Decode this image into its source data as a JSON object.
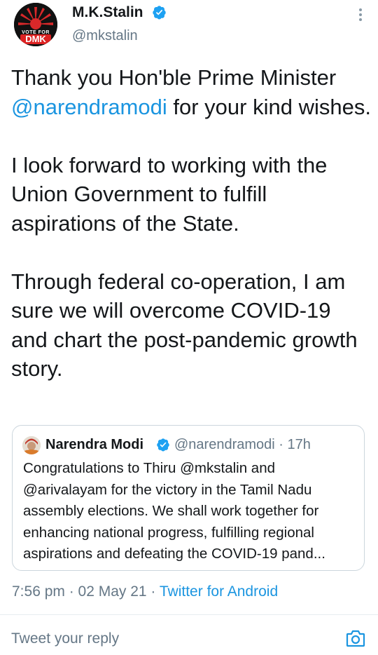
{
  "author": {
    "name": "M.K.Stalin",
    "handle": "@mkstalin",
    "avatar_text_top": "VOTE FOR",
    "avatar_text_main": "DMK"
  },
  "tweet": {
    "line1_before": "Thank you Hon'ble Prime Minister",
    "mention": "@narendramodi",
    "line1_after": " for your kind wishes.",
    "paragraph2": "I look forward to working with the Union Government to fulfill aspirations of the State.",
    "paragraph3": "Through federal co-operation, I am sure we will overcome COVID-19 and chart the post-pandemic growth story."
  },
  "quoted": {
    "name": "Narendra Modi",
    "meta": "@narendramodi · 17h",
    "lines": [
      "Congratulations to Thiru @mkstalin and",
      "@arivalayam for the victory in the Tamil Nadu",
      "assembly elections. We shall work together for",
      "enhancing national progress, fulfilling regional",
      "aspirations and defeating the COVID-19 pand..."
    ]
  },
  "timestamp": "7:56 pm · 02 May 21 · ",
  "source": "Twitter for Android",
  "reply": {
    "placeholder": "Tweet your reply"
  },
  "colors": {
    "link": "#1b95e0",
    "verified": "#1da1f2",
    "secondary": "#657786"
  },
  "icons": [
    "verified-badge-icon",
    "more-options-icon",
    "camera-icon"
  ]
}
